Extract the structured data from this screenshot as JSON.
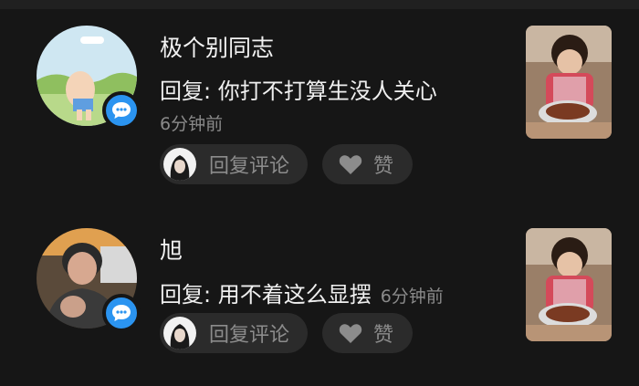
{
  "comments": [
    {
      "name": "极个别同志",
      "reply": "回复: 你打不打算生没人关心",
      "time": "6分钟前",
      "reply_button_label": "回复评论",
      "like_button_label": "赞"
    },
    {
      "name": "旭",
      "reply": "回复: 用不着这么显摆",
      "time": "6分钟前",
      "reply_button_label": "回复评论",
      "like_button_label": "赞"
    }
  ],
  "colors": {
    "background": "#161616",
    "badge": "#2b94f0",
    "button_bg": "#2b2b2b",
    "muted_text": "#8a8a8a"
  },
  "icons": {
    "badge": "chat-bubble-icon",
    "like": "heart-icon"
  }
}
